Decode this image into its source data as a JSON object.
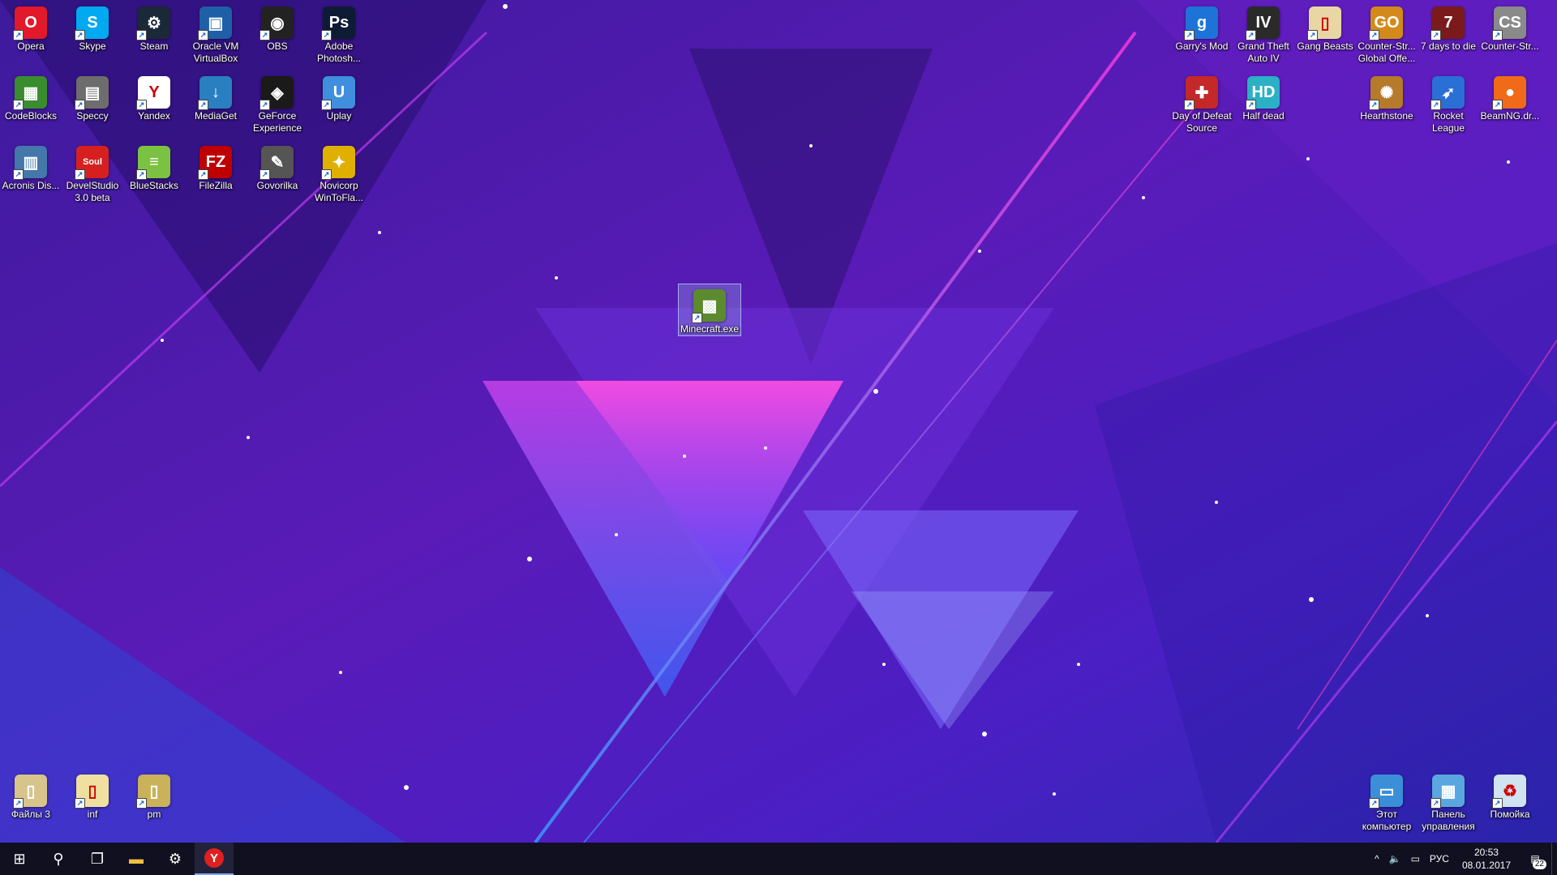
{
  "desktop": {
    "left_icons": [
      {
        "label": "Opera",
        "icon": "opera-icon",
        "color": "#e2182b",
        "glyph": "O"
      },
      {
        "label": "Skype",
        "icon": "skype-icon",
        "color": "#00a9f0",
        "glyph": "S"
      },
      {
        "label": "Steam",
        "icon": "steam-icon",
        "color": "#1b2838",
        "glyph": "⚙"
      },
      {
        "label": "Oracle VM VirtualBox",
        "icon": "virtualbox-icon",
        "color": "#1f5fa8",
        "glyph": "▣"
      },
      {
        "label": "OBS",
        "icon": "obs-icon",
        "color": "#222222",
        "glyph": "◉"
      },
      {
        "label": "Adobe Photosh...",
        "icon": "photoshop-icon",
        "color": "#0d1b35",
        "glyph": "Ps"
      },
      {
        "label": "CodeBlocks",
        "icon": "codeblocks-icon",
        "color": "#3a8d2e",
        "glyph": "▦"
      },
      {
        "label": "Speccy",
        "icon": "speccy-icon",
        "color": "#6d6d6d",
        "glyph": "▤"
      },
      {
        "label": "Yandex",
        "icon": "yandex-icon",
        "color": "#ffffff",
        "glyph": "Y"
      },
      {
        "label": "MediaGet",
        "icon": "mediaget-icon",
        "color": "#2a7fc1",
        "glyph": "↓"
      },
      {
        "label": "GeForce Experience",
        "icon": "geforce-icon",
        "color": "#1a1a1a",
        "glyph": "◈"
      },
      {
        "label": "Uplay",
        "icon": "uplay-icon",
        "color": "#3f8fde",
        "glyph": "U"
      },
      {
        "label": "Acronis Dis...",
        "icon": "acronis-icon",
        "color": "#4477aa",
        "glyph": "▥"
      },
      {
        "label": "DevelStudio 3.0 beta",
        "icon": "develstudio-icon",
        "color": "#d62020",
        "glyph": "Soul"
      },
      {
        "label": "BlueStacks",
        "icon": "bluestacks-icon",
        "color": "#7cc242",
        "glyph": "≡"
      },
      {
        "label": "FileZilla",
        "icon": "filezilla-icon",
        "color": "#bf0000",
        "glyph": "FZ"
      },
      {
        "label": "Govorilka",
        "icon": "govorilka-icon",
        "color": "#555555",
        "glyph": "✎"
      },
      {
        "label": "Novicorp WinToFla...",
        "icon": "wintoflash-icon",
        "color": "#e0b000",
        "glyph": "✦"
      }
    ],
    "right_icons": [
      {
        "label": "Garry's Mod",
        "icon": "garrysmod-icon",
        "color": "#1e73d8",
        "glyph": "g"
      },
      {
        "label": "Grand Theft Auto IV",
        "icon": "gta4-icon",
        "color": "#2a2a2a",
        "glyph": "IV"
      },
      {
        "label": "Gang Beasts",
        "icon": "gangbeasts-icon",
        "color": "#e8d7a4",
        "glyph": "▯"
      },
      {
        "label": "Counter-Str... Global Offe...",
        "icon": "csgo-icon",
        "color": "#d48a1a",
        "glyph": "GO"
      },
      {
        "label": "7 days to die",
        "icon": "7days-icon",
        "color": "#7a1a1a",
        "glyph": "7"
      },
      {
        "label": "Counter-Str...",
        "icon": "counterstrike-icon",
        "color": "#8a8a8a",
        "glyph": "CS"
      },
      {
        "label": "Day of Defeat Source",
        "icon": "dod-icon",
        "color": "#c42828",
        "glyph": "✚"
      },
      {
        "label": "Half dead",
        "icon": "halfdead-icon",
        "color": "#2bb0c6",
        "glyph": "HD"
      },
      {
        "label": "Hearthstone",
        "icon": "hearthstone-icon",
        "color": "#b57a2a",
        "glyph": "✺"
      },
      {
        "label": "Rocket League",
        "icon": "rocketleague-icon",
        "color": "#2a6fd6",
        "glyph": "➶"
      },
      {
        "label": "BeamNG.dr...",
        "icon": "beamng-icon",
        "color": "#f06a1a",
        "glyph": "●"
      }
    ],
    "selected_icon": {
      "label": "Minecraft.exe",
      "icon": "minecraft-icon",
      "color": "#5b8b2e",
      "glyph": "▩"
    },
    "bottom_left_icons": [
      {
        "label": "Файлы 3",
        "icon": "folder-archive-icon",
        "color": "#d7c48a",
        "glyph": "▯"
      },
      {
        "label": "inf",
        "icon": "file-icon",
        "color": "#f0e0a0",
        "glyph": "▯"
      },
      {
        "label": "pm",
        "icon": "archive-icon",
        "color": "#c9b25a",
        "glyph": "▯"
      }
    ],
    "bottom_right_icons": [
      {
        "label": "Этот компьютер",
        "icon": "this-pc-icon",
        "color": "#3b8fd8",
        "glyph": "▭"
      },
      {
        "label": "Панель управления",
        "icon": "control-panel-icon",
        "color": "#5aa6e0",
        "glyph": "▦"
      },
      {
        "label": "Помойка",
        "icon": "recycle-bin-icon",
        "color": "#cfe3f0",
        "glyph": "♻"
      }
    ]
  },
  "taskbar": {
    "buttons": [
      {
        "name": "start-button",
        "icon": "windows-icon",
        "glyph": "⊞"
      },
      {
        "name": "search-button",
        "icon": "search-icon",
        "glyph": "⚲"
      },
      {
        "name": "task-view-button",
        "icon": "task-view-icon",
        "glyph": "❐"
      },
      {
        "name": "file-explorer-button",
        "icon": "folder-icon",
        "glyph": "▬"
      },
      {
        "name": "steam-taskbar-button",
        "icon": "steam-icon",
        "glyph": "⚙"
      },
      {
        "name": "yandex-taskbar-button",
        "icon": "yandex-icon",
        "glyph": "Y"
      }
    ],
    "tray": {
      "chevron": "^",
      "volume": "🔈",
      "network": "▭",
      "language": "РУС",
      "time": "20:53",
      "date": "08.01.2017",
      "notifications_count": "22"
    }
  }
}
